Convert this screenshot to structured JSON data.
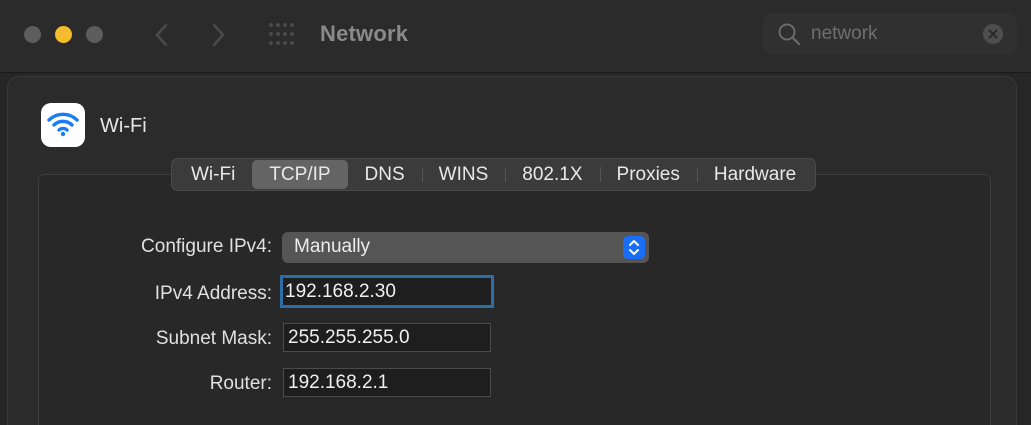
{
  "window": {
    "title": "Network"
  },
  "search": {
    "value": "network"
  },
  "service": {
    "name": "Wi-Fi"
  },
  "tabs": [
    {
      "label": "Wi-Fi"
    },
    {
      "label": "TCP/IP"
    },
    {
      "label": "DNS"
    },
    {
      "label": "WINS"
    },
    {
      "label": "802.1X"
    },
    {
      "label": "Proxies"
    },
    {
      "label": "Hardware"
    }
  ],
  "active_tab": "TCP/IP",
  "form": {
    "configure_label": "Configure IPv4:",
    "configure_value": "Manually",
    "ipv4_label": "IPv4 Address:",
    "ipv4_value": "192.168.2.30",
    "subnet_label": "Subnet Mask:",
    "subnet_value": "255.255.255.0",
    "router_label": "Router:",
    "router_value": "192.168.2.1"
  },
  "colors": {
    "accent": "#1a6ef5",
    "focus_ring": "#2b6ea6",
    "minimize_button": "#f5bc2f",
    "wifi_icon": "#1a7cf2"
  }
}
